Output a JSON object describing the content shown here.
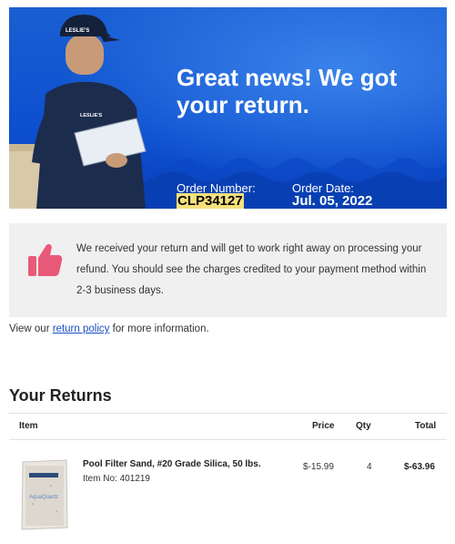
{
  "hero": {
    "headline": "Great news! We got your return.",
    "order_number_label": "Order Number:",
    "order_number": "CLP34127",
    "order_date_label": "Order Date:",
    "order_date": "Jul. 05, 2022",
    "brand_logo": "LESLIE'S",
    "colors": {
      "background": "#0d4fcf",
      "highlight": "#f6e07a"
    }
  },
  "notice": {
    "icon": "thumbs-up-icon",
    "text": "We received your return and will get to work right away on processing your refund. You should see the charges credited to your payment method within 2-3 business days."
  },
  "policy": {
    "prefix": "View our ",
    "link": "return policy",
    "suffix": " for more information."
  },
  "returns": {
    "title": "Your Returns",
    "columns": {
      "item": "Item",
      "price": "Price",
      "qty": "Qty",
      "total": "Total"
    },
    "items": [
      {
        "name": "Pool Filter Sand, #20 Grade Silica, 50 lbs.",
        "item_no": "Item No: 401219",
        "price": "$-15.99",
        "qty": "4",
        "total": "$-63.96",
        "image_label": "AquaQuartz"
      }
    ]
  }
}
